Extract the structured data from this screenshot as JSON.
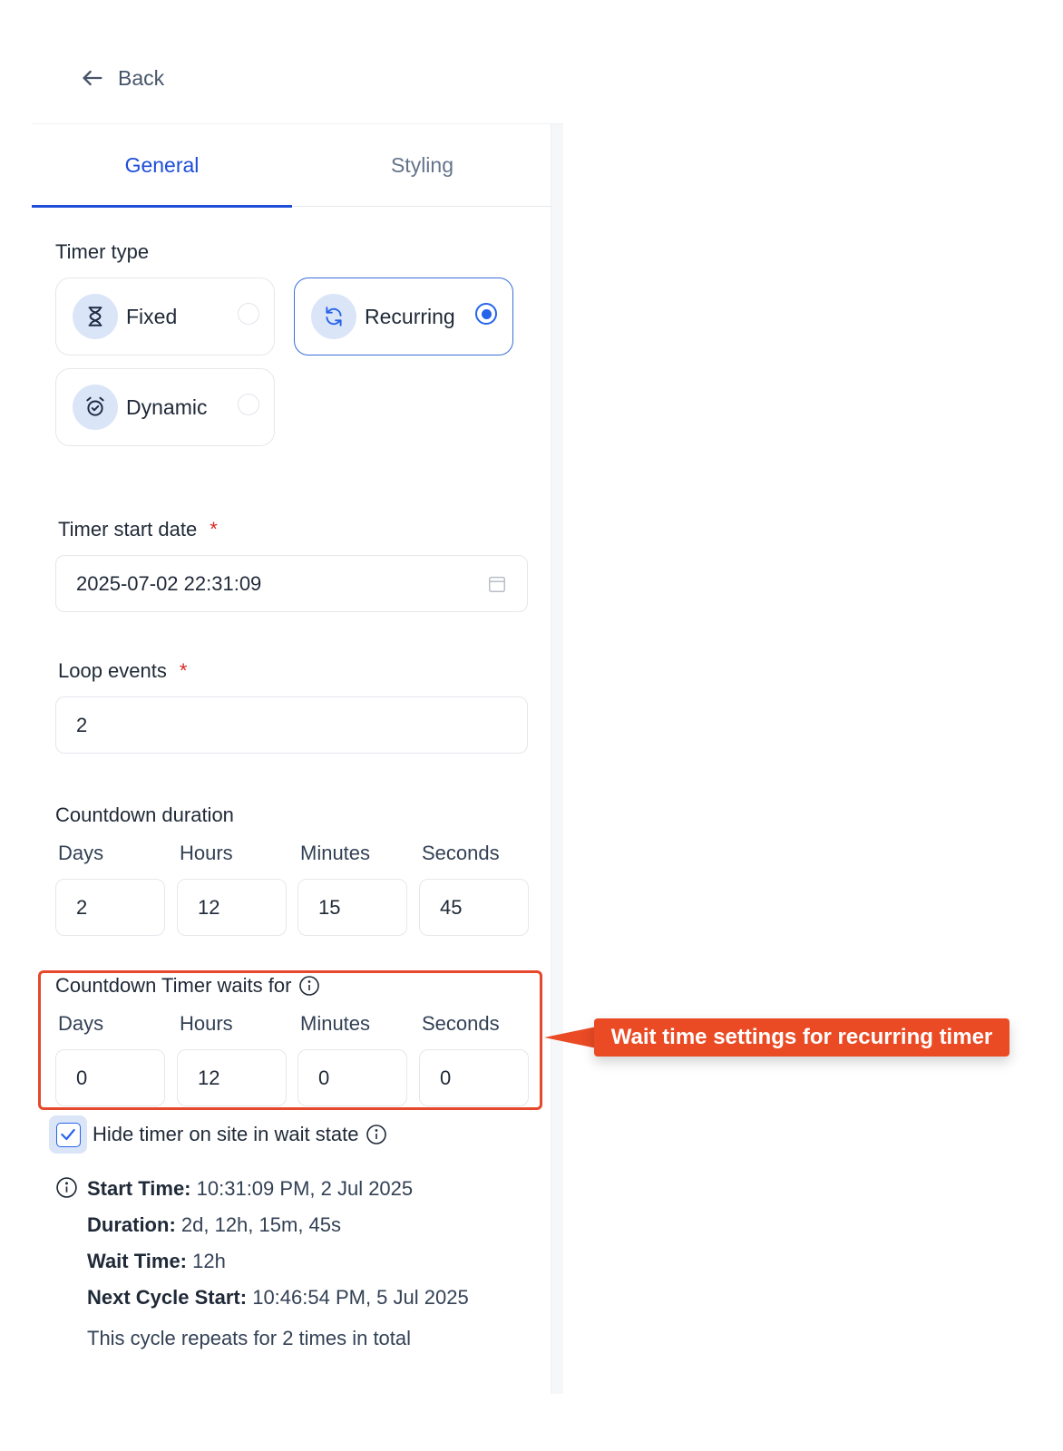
{
  "back": {
    "label": "Back"
  },
  "tabs": [
    {
      "label": "General",
      "active": true
    },
    {
      "label": "Styling",
      "active": false
    }
  ],
  "timer_type": {
    "label": "Timer type",
    "options": [
      {
        "label": "Fixed",
        "icon": "hourglass-icon",
        "selected": false
      },
      {
        "label": "Recurring",
        "icon": "refresh-icon",
        "selected": true
      },
      {
        "label": "Dynamic",
        "icon": "alarm-clock-icon",
        "selected": false
      }
    ]
  },
  "start_date": {
    "label": "Timer start date",
    "required_mark": "*",
    "value": "2025-07-02 22:31:09",
    "icon": "calendar-icon"
  },
  "loop_events": {
    "label": "Loop events",
    "required_mark": "*",
    "value": "2"
  },
  "countdown_duration": {
    "label": "Countdown duration",
    "fields": [
      {
        "label": "Days",
        "value": "2"
      },
      {
        "label": "Hours",
        "value": "12"
      },
      {
        "label": "Minutes",
        "value": "15"
      },
      {
        "label": "Seconds",
        "value": "45"
      }
    ]
  },
  "wait": {
    "label": "Countdown Timer waits for",
    "fields": [
      {
        "label": "Days",
        "value": "0"
      },
      {
        "label": "Hours",
        "value": "12"
      },
      {
        "label": "Minutes",
        "value": "0"
      },
      {
        "label": "Seconds",
        "value": "0"
      }
    ]
  },
  "hide_timer": {
    "label": "Hide timer on site in wait state",
    "checked": true
  },
  "summary": {
    "start_label": "Start Time:",
    "start_value": "10:31:09 PM, 2 Jul 2025",
    "duration_label": "Duration:",
    "duration_value": "2d, 12h, 15m, 45s",
    "wait_label": "Wait Time:",
    "wait_value": "12h",
    "next_label": "Next Cycle Start:",
    "next_value": "10:46:54 PM, 5 Jul 2025",
    "repeat_text": "This cycle repeats for 2 times in total"
  },
  "annotation": {
    "text": "Wait time settings for recurring timer",
    "color": "#ea4a24"
  },
  "colors": {
    "accent": "#1d4ed8",
    "required": "#dc2626"
  }
}
